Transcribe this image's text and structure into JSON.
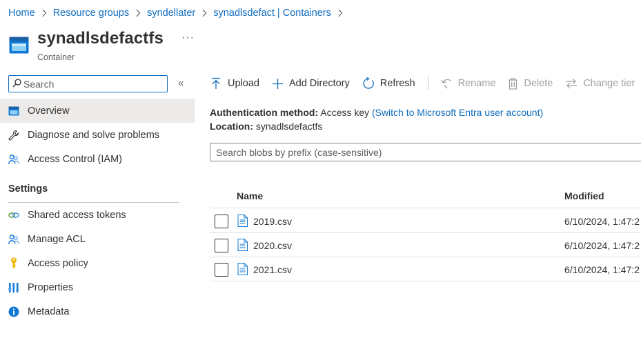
{
  "breadcrumb": [
    "Home",
    "Resource groups",
    "syndellater",
    "synadlsdefact | Containers"
  ],
  "header": {
    "title": "synadlsdefactfs",
    "subtitle": "Container",
    "more": "···"
  },
  "sidebar": {
    "search_placeholder": "Search",
    "collapse": "«",
    "items": [
      {
        "label": "Overview",
        "icon": "container-icon"
      },
      {
        "label": "Diagnose and solve problems",
        "icon": "wrench-icon"
      },
      {
        "label": "Access Control (IAM)",
        "icon": "people-icon"
      }
    ],
    "settings_header": "Settings",
    "settings_items": [
      {
        "label": "Shared access tokens",
        "icon": "link-icon"
      },
      {
        "label": "Manage ACL",
        "icon": "people-icon"
      },
      {
        "label": "Access policy",
        "icon": "key-icon"
      },
      {
        "label": "Properties",
        "icon": "properties-icon"
      },
      {
        "label": "Metadata",
        "icon": "info-icon"
      }
    ]
  },
  "toolbar": {
    "upload": "Upload",
    "add_directory": "Add Directory",
    "refresh": "Refresh",
    "rename": "Rename",
    "delete": "Delete",
    "change_tier": "Change tier"
  },
  "info": {
    "auth_label": "Authentication method:",
    "auth_value": "Access key",
    "auth_link": "(Switch to Microsoft Entra user account)",
    "location_label": "Location:",
    "location_value": "synadlsdefactfs"
  },
  "blob_search_placeholder": "Search blobs by prefix (case-sensitive)",
  "table": {
    "columns": [
      "Name",
      "Modified"
    ],
    "rows": [
      {
        "name": "2019.csv",
        "modified": "6/10/2024, 1:47:2"
      },
      {
        "name": "2020.csv",
        "modified": "6/10/2024, 1:47:2"
      },
      {
        "name": "2021.csv",
        "modified": "6/10/2024, 1:47:2"
      }
    ]
  },
  "colors": {
    "accent": "#0f6cbd",
    "text": "#323130",
    "muted": "#605e5c",
    "disabled": "#a19f9d",
    "active_bg": "#edebe9"
  }
}
